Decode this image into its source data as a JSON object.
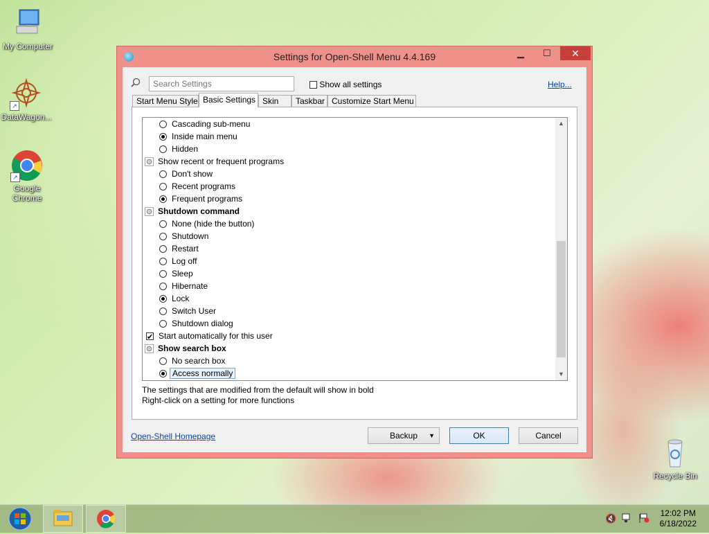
{
  "desktop": {
    "icons": [
      {
        "label": "My Computer",
        "icon": "computer-icon"
      },
      {
        "label": "DataWagon...",
        "icon": "datawagon-icon"
      },
      {
        "label": "Google Chrome",
        "icon": "chrome-icon"
      },
      {
        "label": "Recycle Bin",
        "icon": "recycle-bin-icon"
      }
    ]
  },
  "dialog": {
    "title": "Settings for Open-Shell Menu 4.4.169",
    "search_placeholder": "Search Settings",
    "show_all_label": "Show all settings",
    "help_label": "Help...",
    "tabs": [
      {
        "label": "Start Menu Style",
        "active": false
      },
      {
        "label": "Basic Settings",
        "active": true
      },
      {
        "label": "Skin",
        "active": false
      },
      {
        "label": "Taskbar",
        "active": false
      },
      {
        "label": "Customize Start Menu",
        "active": false
      }
    ],
    "settings": [
      {
        "type": "radio",
        "label": "Cascading sub-menu",
        "checked": false
      },
      {
        "type": "radio",
        "label": "Inside main menu",
        "checked": true
      },
      {
        "type": "radio",
        "label": "Hidden",
        "checked": false
      },
      {
        "type": "group",
        "label": "Show recent or frequent programs",
        "bold": false
      },
      {
        "type": "radio",
        "label": "Don't show",
        "checked": false
      },
      {
        "type": "radio",
        "label": "Recent programs",
        "checked": false
      },
      {
        "type": "radio",
        "label": "Frequent programs",
        "checked": true
      },
      {
        "type": "group",
        "label": "Shutdown command",
        "bold": true
      },
      {
        "type": "radio",
        "label": "None (hide the button)",
        "checked": false
      },
      {
        "type": "radio",
        "label": "Shutdown",
        "checked": false
      },
      {
        "type": "radio",
        "label": "Restart",
        "checked": false
      },
      {
        "type": "radio",
        "label": "Log off",
        "checked": false
      },
      {
        "type": "radio",
        "label": "Sleep",
        "checked": false
      },
      {
        "type": "radio",
        "label": "Hibernate",
        "checked": false
      },
      {
        "type": "radio",
        "label": "Lock",
        "checked": true
      },
      {
        "type": "radio",
        "label": "Switch User",
        "checked": false
      },
      {
        "type": "radio",
        "label": "Shutdown dialog",
        "checked": false
      },
      {
        "type": "checkbox",
        "label": "Start automatically for this user",
        "checked": true
      },
      {
        "type": "group",
        "label": "Show search box",
        "bold": true
      },
      {
        "type": "radio",
        "label": "No search box",
        "checked": false
      },
      {
        "type": "radio",
        "label": "Access normally",
        "checked": true,
        "selected": true
      }
    ],
    "hint_line1": "The settings that are modified from the default will show in bold",
    "hint_line2": "Right-click on a setting for more functions",
    "homepage_link": "Open-Shell Homepage",
    "backup_label": "Backup",
    "ok_label": "OK",
    "cancel_label": "Cancel"
  },
  "taskbar": {
    "time": "12:02 PM",
    "date": "6/18/2022"
  },
  "colors": {
    "window_frame": "#f0908a",
    "close_button": "#c73e3a",
    "link": "#0645ad"
  }
}
